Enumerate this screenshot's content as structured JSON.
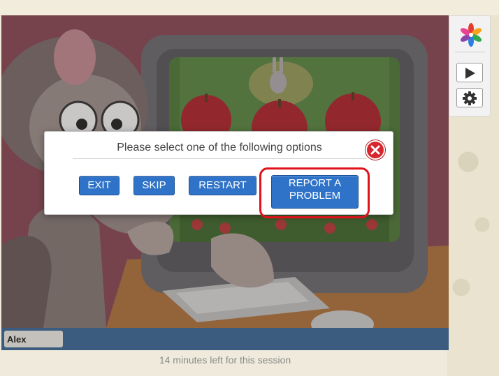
{
  "dialog": {
    "title": "Please select one of the following options",
    "buttons": {
      "exit": "EXIT",
      "skip": "SKIP",
      "restart": "RESTART",
      "report_line1": "REPORT A",
      "report_line2": "PROBLEM"
    },
    "close_icon": "close-x-icon",
    "highlight_color": "#e1121b"
  },
  "sidebar": {
    "logo_icon": "pinwheel-logo-icon",
    "play_icon": "play-icon",
    "settings_icon": "gear-icon"
  },
  "player": {
    "user_name": "Alex",
    "time_remaining": "14 minutes left for this session"
  },
  "colors": {
    "button_blue": "#2f73c9",
    "close_red": "#d7262d",
    "bar_blue": "#3b5c7e"
  }
}
